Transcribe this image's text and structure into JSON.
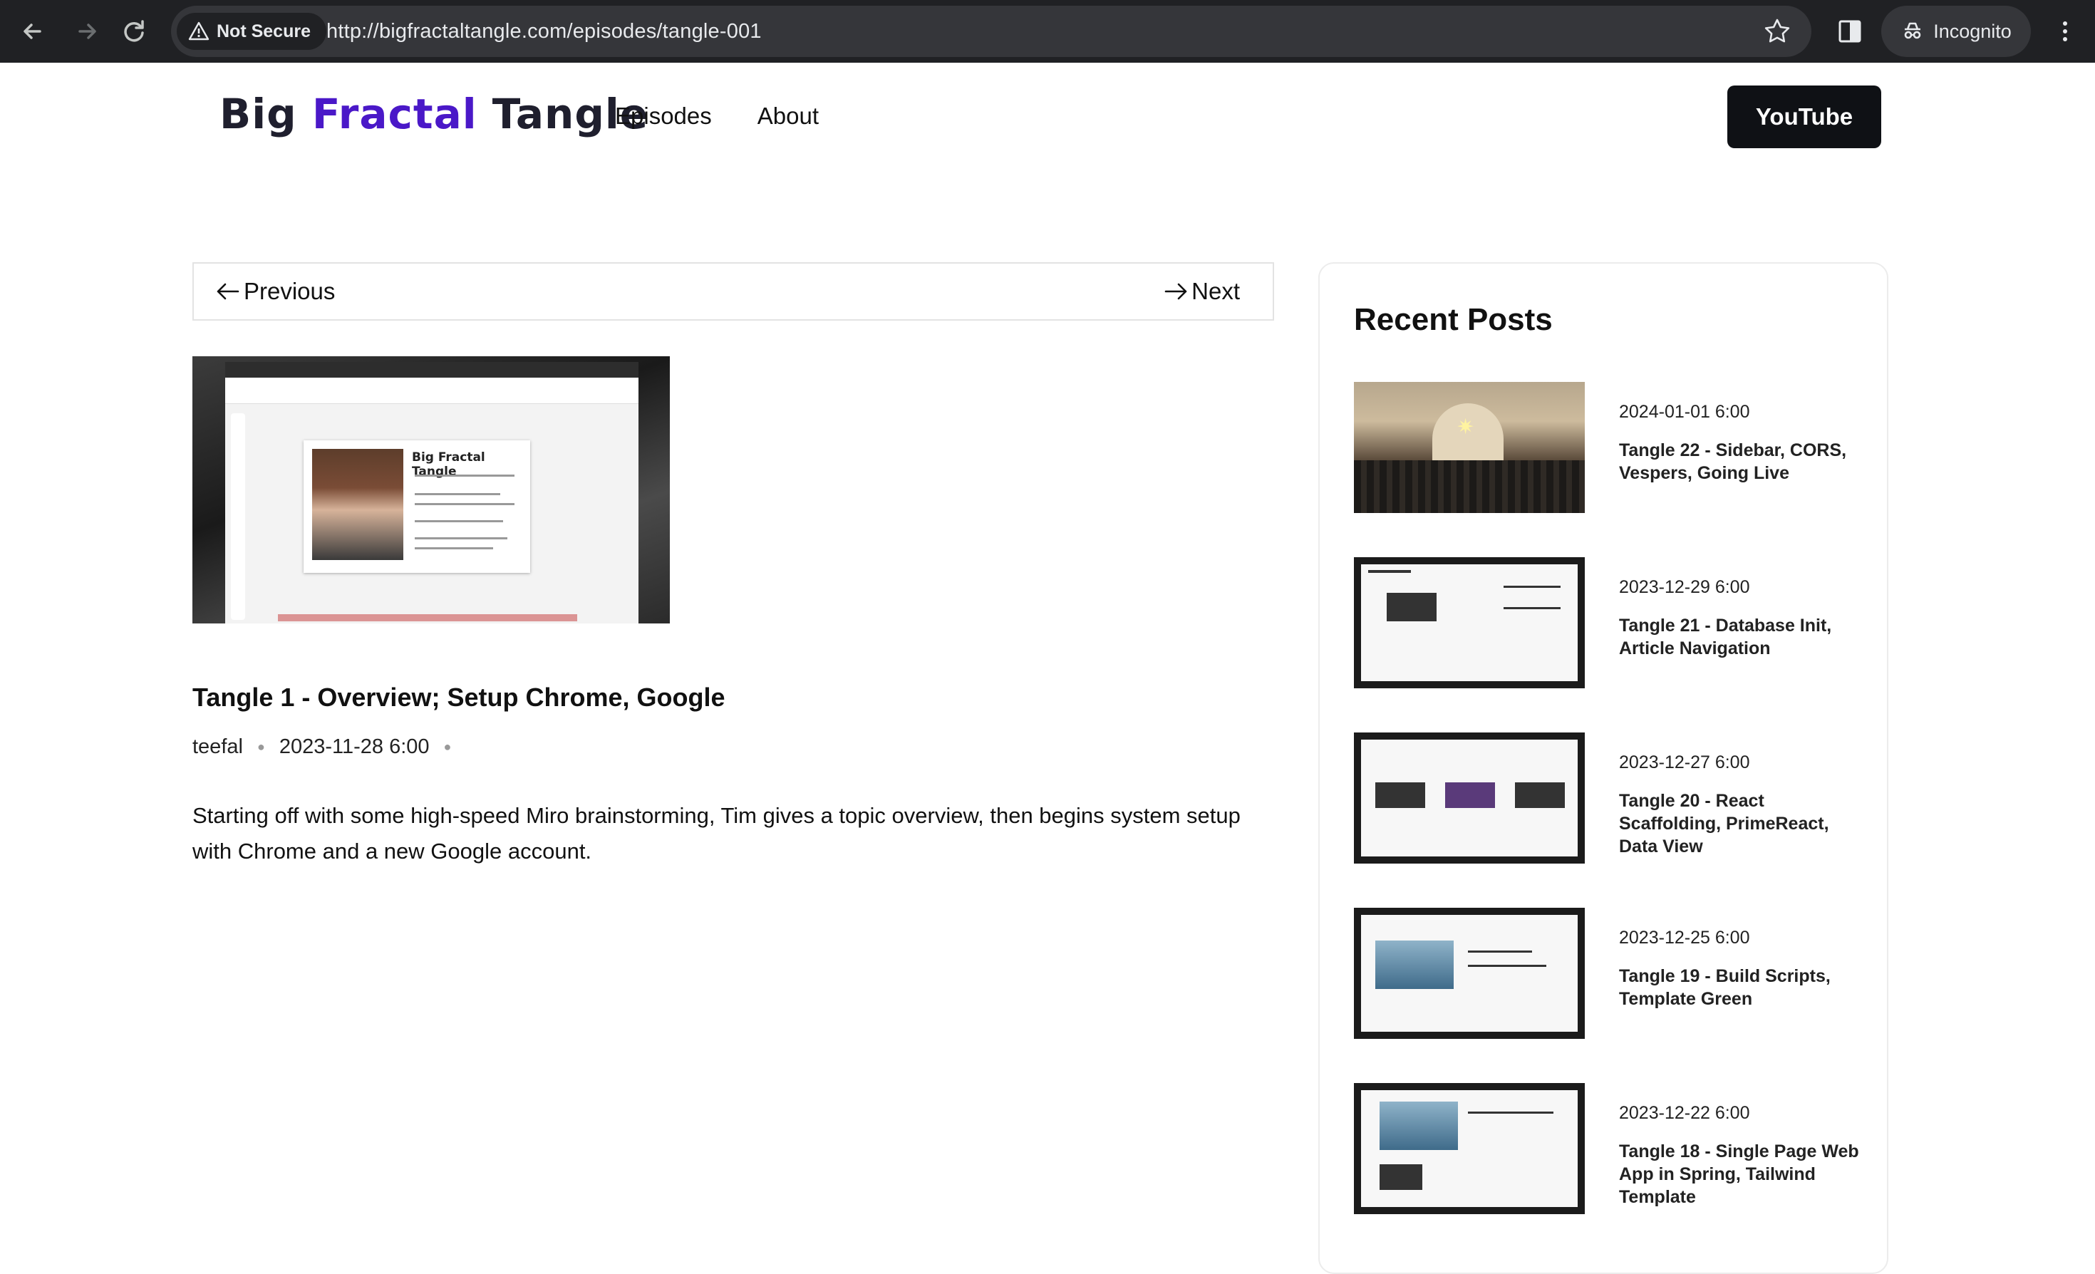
{
  "browser": {
    "security_label": "Not Secure",
    "url": "http://bigfractaltangle.com/episodes/tangle-001",
    "profile_label": "Incognito"
  },
  "site": {
    "logo": {
      "part1": "Big",
      "part2": "Fractal",
      "part3": "Tangle"
    },
    "nav": {
      "episodes": "Episodes",
      "about": "About"
    },
    "youtube_label": "YouTube"
  },
  "article": {
    "prev_label": "Previous",
    "next_label": "Next",
    "hero": {
      "card_title": "Big Fractal Tangle"
    },
    "title": "Tangle 1 - Overview; Setup Chrome, Google",
    "author": "teefal",
    "date": "2023-11-28 6:00",
    "summary": "Starting off with some high-speed Miro brainstorming, Tim gives a topic overview, then begins system setup with Chrome and a new Google account."
  },
  "sidebar": {
    "heading": "Recent Posts",
    "posts": [
      {
        "date": "2024-01-01 6:00",
        "title": "Tangle 22 - Sidebar, CORS, Vespers, Going Live"
      },
      {
        "date": "2023-12-29 6:00",
        "title": "Tangle 21 - Database Init, Article Navigation"
      },
      {
        "date": "2023-12-27 6:00",
        "title": "Tangle 20 - React Scaffolding, PrimeReact, Data View"
      },
      {
        "date": "2023-12-25 6:00",
        "title": "Tangle 19 - Build Scripts, Template Green"
      },
      {
        "date": "2023-12-22 6:00",
        "title": "Tangle 18 - Single Page Web App in Spring, Tailwind Template"
      }
    ]
  },
  "colors": {
    "logo_accent": "#4a18c8",
    "youtube_button": "#0f1115",
    "chrome_bg": "#202124"
  },
  "icons": [
    "back-arrow-icon",
    "forward-arrow-icon",
    "reload-icon",
    "warning-icon",
    "star-icon",
    "side-panel-icon",
    "incognito-icon",
    "more-menu-icon",
    "arrow-left-icon",
    "arrow-right-icon"
  ]
}
